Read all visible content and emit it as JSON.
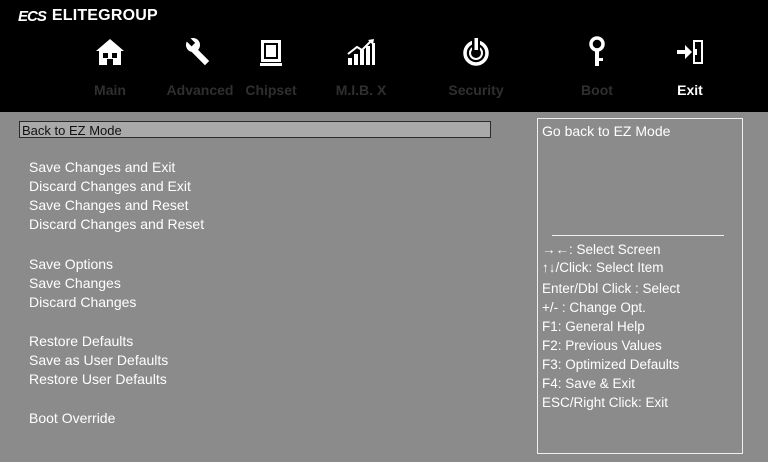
{
  "header": {
    "logo_mark": "ECS",
    "brand": "ELITEGROUP"
  },
  "tabs": [
    {
      "label": "Main",
      "icon": "home-icon"
    },
    {
      "label": "Advanced",
      "icon": "wrench-icon"
    },
    {
      "label": "Chipset",
      "icon": "chip-icon"
    },
    {
      "label": "M.I.B. X",
      "icon": "chart-icon"
    },
    {
      "label": "Security",
      "icon": "power-icon"
    },
    {
      "label": "Boot",
      "icon": "key-icon"
    },
    {
      "label": "Exit",
      "icon": "exit-icon"
    }
  ],
  "active_tab": "Exit",
  "menu": {
    "selected": "Back to EZ Mode",
    "groups": [
      [
        "Save Changes and Exit",
        "Discard Changes and Exit",
        "Save Changes and Reset",
        "Discard Changes and Reset"
      ],
      [
        "Save Options",
        "Save Changes",
        "Discard Changes"
      ],
      [
        "Restore Defaults",
        "Save as User Defaults",
        "Restore User Defaults"
      ],
      [
        "Boot Override"
      ]
    ]
  },
  "help": {
    "description": "Go back to EZ Mode",
    "keys": [
      "→←: Select Screen",
      "↑↓/Click: Select Item",
      "Enter/Dbl Click : Select",
      "+/- : Change Opt.",
      "F1: General Help",
      "F2: Previous Values",
      "F3: Optimized Defaults",
      "F4: Save & Exit",
      "ESC/Right Click: Exit"
    ]
  },
  "colors": {
    "topbar": "#000000",
    "background": "#8b8b8b",
    "active_tab_text": "#ffffff",
    "inactive_tab_text": "#2f2f2f"
  }
}
